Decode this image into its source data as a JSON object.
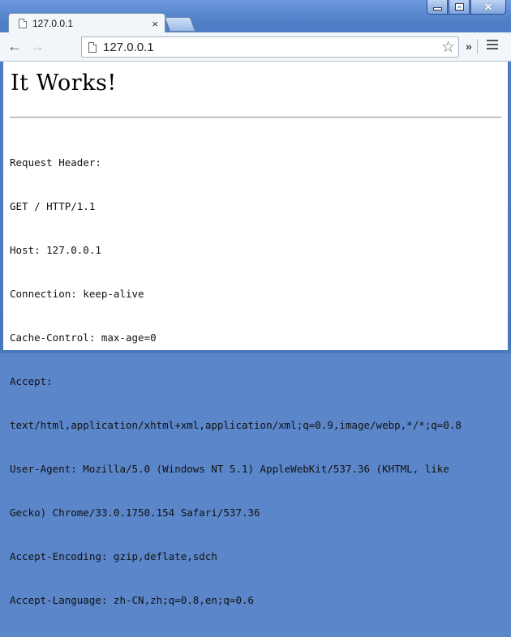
{
  "tab": {
    "title": "127.0.0.1",
    "close": "×"
  },
  "window": {
    "min": "",
    "max": "",
    "close": "✕"
  },
  "toolbar": {
    "back": "←",
    "forward": "→",
    "url": "127.0.0.1",
    "star": "☆",
    "extensions": "»"
  },
  "page": {
    "heading": "It Works!",
    "lines": [
      "Request Header:",
      "GET / HTTP/1.1",
      "Host: 127.0.0.1",
      "Connection: keep-alive",
      "Cache-Control: max-age=0",
      "Accept:",
      "text/html,application/xhtml+xml,application/xml;q=0.9,image/webp,*/*;q=0.8",
      "User-Agent: Mozilla/5.0 (Windows NT 5.1) AppleWebKit/537.36 (KHTML, like",
      "Gecko) Chrome/33.0.1750.154 Safari/537.36",
      "Accept-Encoding: gzip,deflate,sdch",
      "Accept-Language: zh-CN,zh;q=0.8,en;q=0.6"
    ]
  }
}
